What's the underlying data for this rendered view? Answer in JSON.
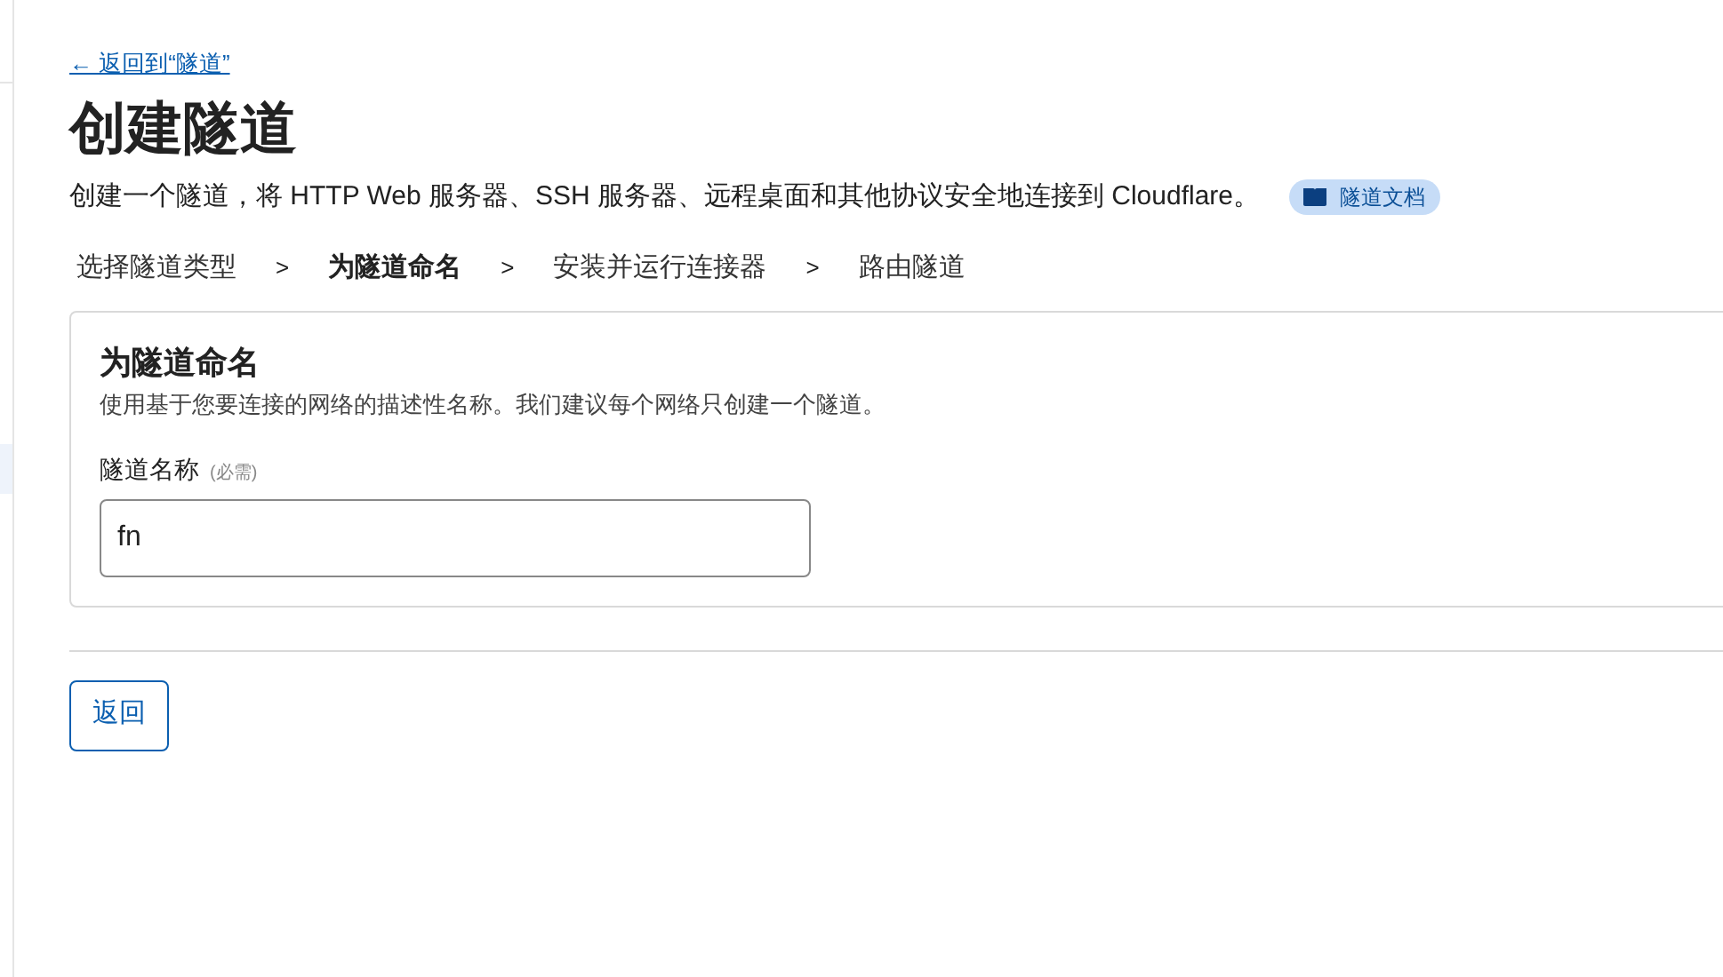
{
  "back_link": "← 返回到“隧道”",
  "title": "创建隧道",
  "description": "创建一个隧道，将 HTTP Web 服务器、SSH 服务器、远程桌面和其他协议安全地连接到 Cloudflare。",
  "docs_badge": "隧道文档",
  "steps": [
    {
      "label": "选择隧道类型",
      "selected": false
    },
    {
      "label": "为隧道命名",
      "selected": true
    },
    {
      "label": "安装并运行连接器",
      "selected": false
    },
    {
      "label": "路由隧道",
      "selected": false
    }
  ],
  "step_separator": ">",
  "card": {
    "title": "为隧道命名",
    "subtitle": "使用基于您要连接的网络的描述性名称。我们建议每个网络只创建一个隧道。",
    "field_label": "隧道名称",
    "field_hint": "(必需)",
    "field_value": "fn"
  },
  "buttons": [
    "返回"
  ]
}
